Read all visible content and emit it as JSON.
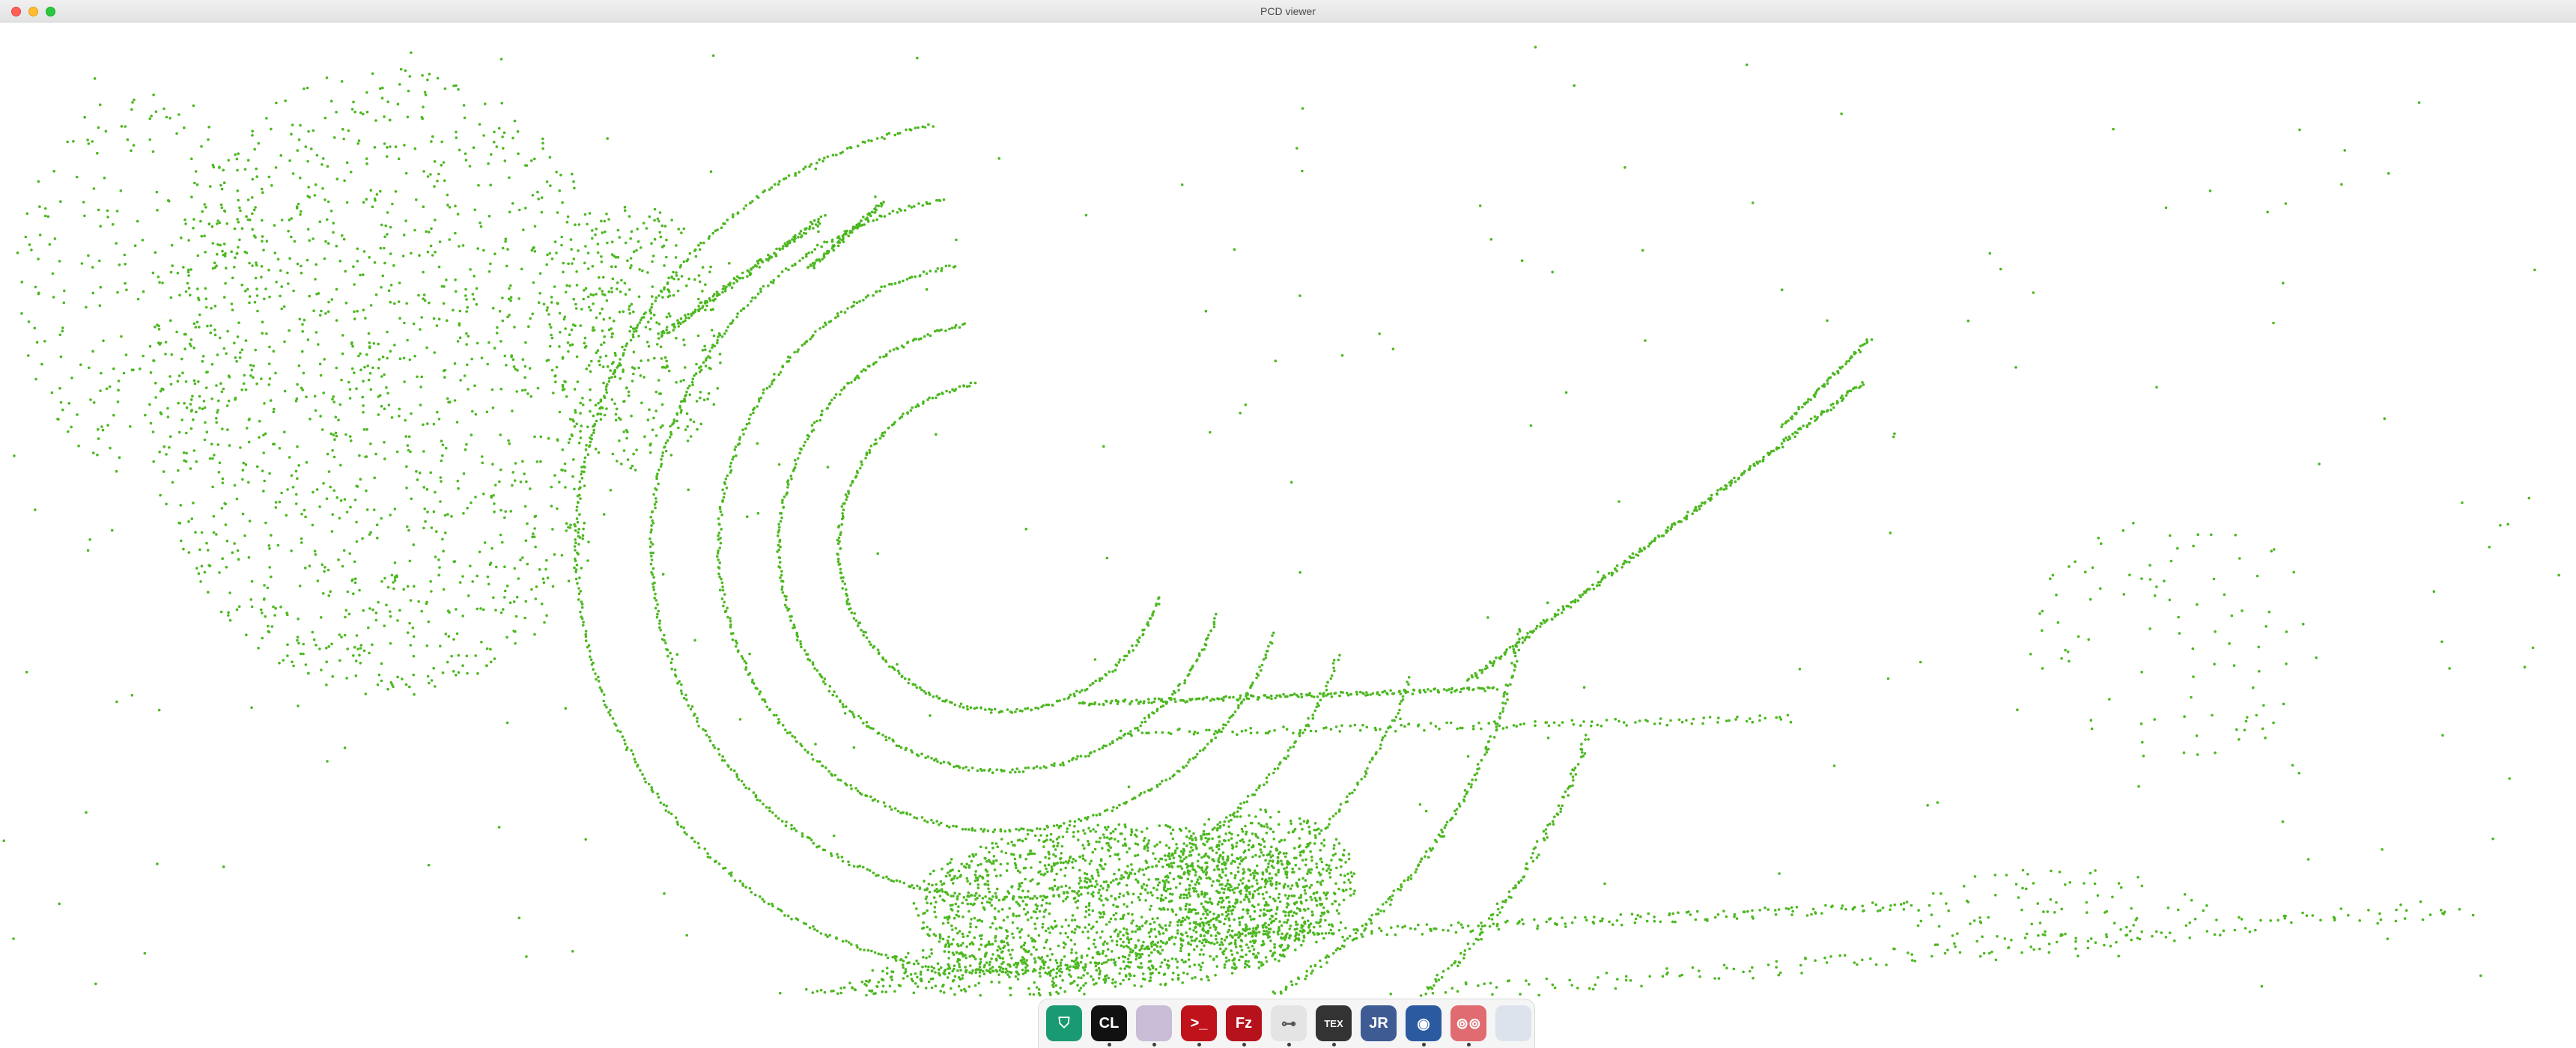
{
  "window": {
    "title": "PCD viewer",
    "buttons": {
      "close": "close",
      "minimize": "minimize",
      "maximize": "maximize"
    }
  },
  "scene": {
    "point_color": "#4cb820",
    "background_color": "#ffffff"
  },
  "dock": {
    "items": [
      {
        "name": "vpn-app-icon",
        "glyph": "⛉",
        "color": "#1a9a73",
        "running": false
      },
      {
        "name": "clion-icon",
        "glyph": "CL",
        "color": "#111111",
        "running": true
      },
      {
        "name": "folder-icon",
        "glyph": "",
        "color": "#c8bcd6",
        "running": true
      },
      {
        "name": "terminal-icon",
        "glyph": ">_",
        "color": "#c0121b",
        "running": true
      },
      {
        "name": "filezilla-icon",
        "glyph": "Fz",
        "color": "#b5121b",
        "running": true
      },
      {
        "name": "switch-settings-icon",
        "glyph": "⊶",
        "color": "#e4e4e4",
        "running": true
      },
      {
        "name": "tex-icon",
        "glyph": "TEX",
        "color": "#333333",
        "running": true
      },
      {
        "name": "jabref-icon",
        "glyph": "JR",
        "color": "#3e5b93",
        "running": false
      },
      {
        "name": "screenshot-icon",
        "glyph": "◉",
        "color": "#2c5aa0",
        "running": true
      },
      {
        "name": "reader-icon",
        "glyph": "⊚⊚",
        "color": "#e06b70",
        "running": true
      },
      {
        "name": "window-icon",
        "glyph": "",
        "color": "#dde3ec",
        "running": false
      }
    ]
  }
}
